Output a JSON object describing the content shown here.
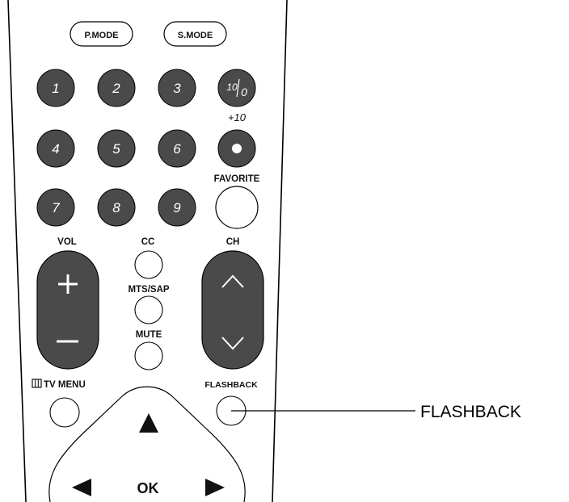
{
  "buttons": {
    "p_mode": "P.MODE",
    "s_mode": "S.MODE",
    "digits": [
      "1",
      "2",
      "3",
      "4",
      "5",
      "6",
      "7",
      "8",
      "9"
    ],
    "ten_zero_a": "10",
    "ten_zero_b": "0",
    "plus_ten": "+10",
    "favorite": "FAVORITE",
    "vol": "VOL",
    "cc": "CC",
    "ch": "CH",
    "mts_sap": "MTS/SAP",
    "mute": "MUTE",
    "tv_menu": "TV MENU",
    "flashback": "FLASHBACK",
    "ok": "OK"
  },
  "callout": {
    "label": "FLASHBACK"
  },
  "icons": {
    "vol_plus": "plus-icon",
    "vol_minus": "minus-icon",
    "ch_up": "chevron-up-icon",
    "ch_down": "chevron-down-icon",
    "up": "triangle-up-icon",
    "left": "triangle-left-icon",
    "right": "triangle-right-icon",
    "menu": "menu-icon",
    "dot": "dot-icon"
  },
  "colors": {
    "button_dark": "#4a4a4a",
    "line": "#000000"
  }
}
